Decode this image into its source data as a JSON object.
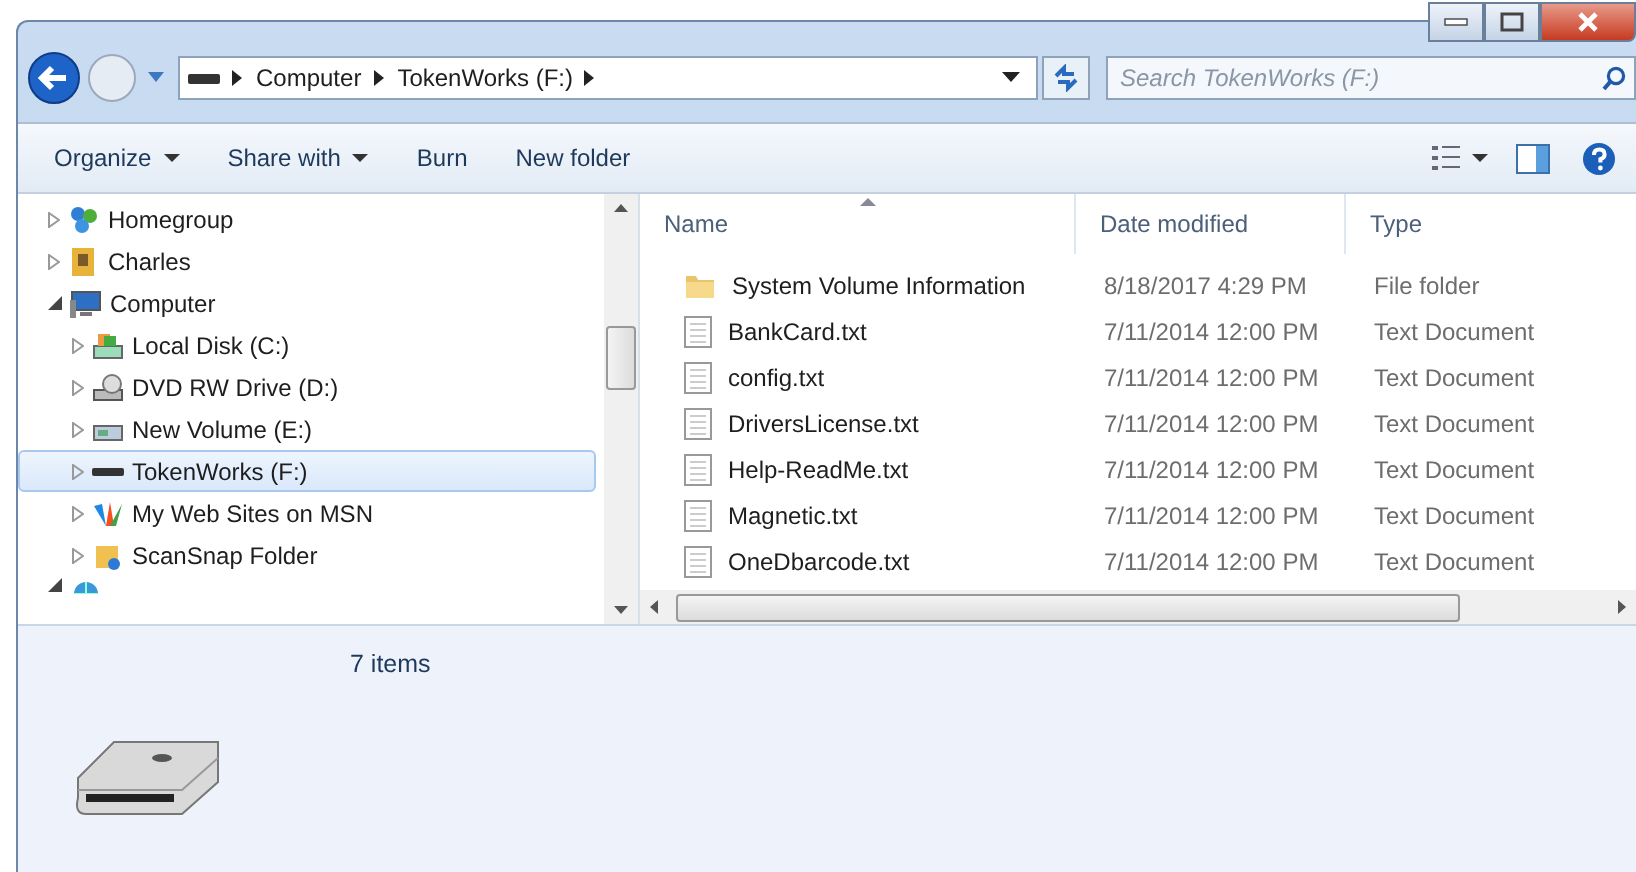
{
  "address_bar": {
    "crumbs": [
      "Computer",
      "TokenWorks (F:)"
    ]
  },
  "search": {
    "placeholder": "Search TokenWorks (F:)"
  },
  "toolbar": {
    "buttons": [
      {
        "label": "Organize",
        "dropdown": true
      },
      {
        "label": "Share with",
        "dropdown": true
      },
      {
        "label": "Burn",
        "dropdown": false
      },
      {
        "label": "New folder",
        "dropdown": false
      }
    ]
  },
  "navigation": {
    "items": [
      {
        "label": "Homegroup",
        "kind": "homegroup",
        "expanded": false,
        "selected": false
      },
      {
        "label": "Charles",
        "kind": "user",
        "expanded": false,
        "selected": false
      },
      {
        "label": "Computer",
        "kind": "computer",
        "expanded": true,
        "selected": false,
        "children": [
          {
            "label": "Local Disk (C:)",
            "kind": "disk",
            "expanded": false,
            "selected": false
          },
          {
            "label": "DVD RW Drive (D:)",
            "kind": "dvd",
            "expanded": false,
            "selected": false
          },
          {
            "label": "New Volume (E:)",
            "kind": "volume",
            "expanded": false,
            "selected": false
          },
          {
            "label": "TokenWorks (F:)",
            "kind": "usb",
            "expanded": false,
            "selected": true
          },
          {
            "label": "My Web Sites on MSN",
            "kind": "msn",
            "expanded": false,
            "selected": false
          },
          {
            "label": "ScanSnap Folder",
            "kind": "scansnap",
            "expanded": false,
            "selected": false
          }
        ]
      },
      {
        "kind": "network",
        "expanded": true,
        "selected": false
      }
    ]
  },
  "file_list": {
    "columns": [
      {
        "label": "Name",
        "sorted": true
      },
      {
        "label": "Date modified",
        "sorted": false
      },
      {
        "label": "Type",
        "sorted": false
      }
    ],
    "rows": [
      {
        "kind": "folder",
        "name": "System Volume Information",
        "date": "8/18/2017 4:29 PM",
        "type": "File folder"
      },
      {
        "kind": "text",
        "name": "BankCard.txt",
        "date": "7/11/2014 12:00 PM",
        "type": "Text Document"
      },
      {
        "kind": "text",
        "name": "config.txt",
        "date": "7/11/2014 12:00 PM",
        "type": "Text Document"
      },
      {
        "kind": "text",
        "name": "DriversLicense.txt",
        "date": "7/11/2014 12:00 PM",
        "type": "Text Document"
      },
      {
        "kind": "text",
        "name": "Help-ReadMe.txt",
        "date": "7/11/2014 12:00 PM",
        "type": "Text Document"
      },
      {
        "kind": "text",
        "name": "Magnetic.txt",
        "date": "7/11/2014 12:00 PM",
        "type": "Text Document"
      },
      {
        "kind": "text",
        "name": "OneDbarcode.txt",
        "date": "7/11/2014 12:00 PM",
        "type": "Text Document"
      }
    ]
  },
  "details_pane": {
    "item_count": "7 items"
  }
}
